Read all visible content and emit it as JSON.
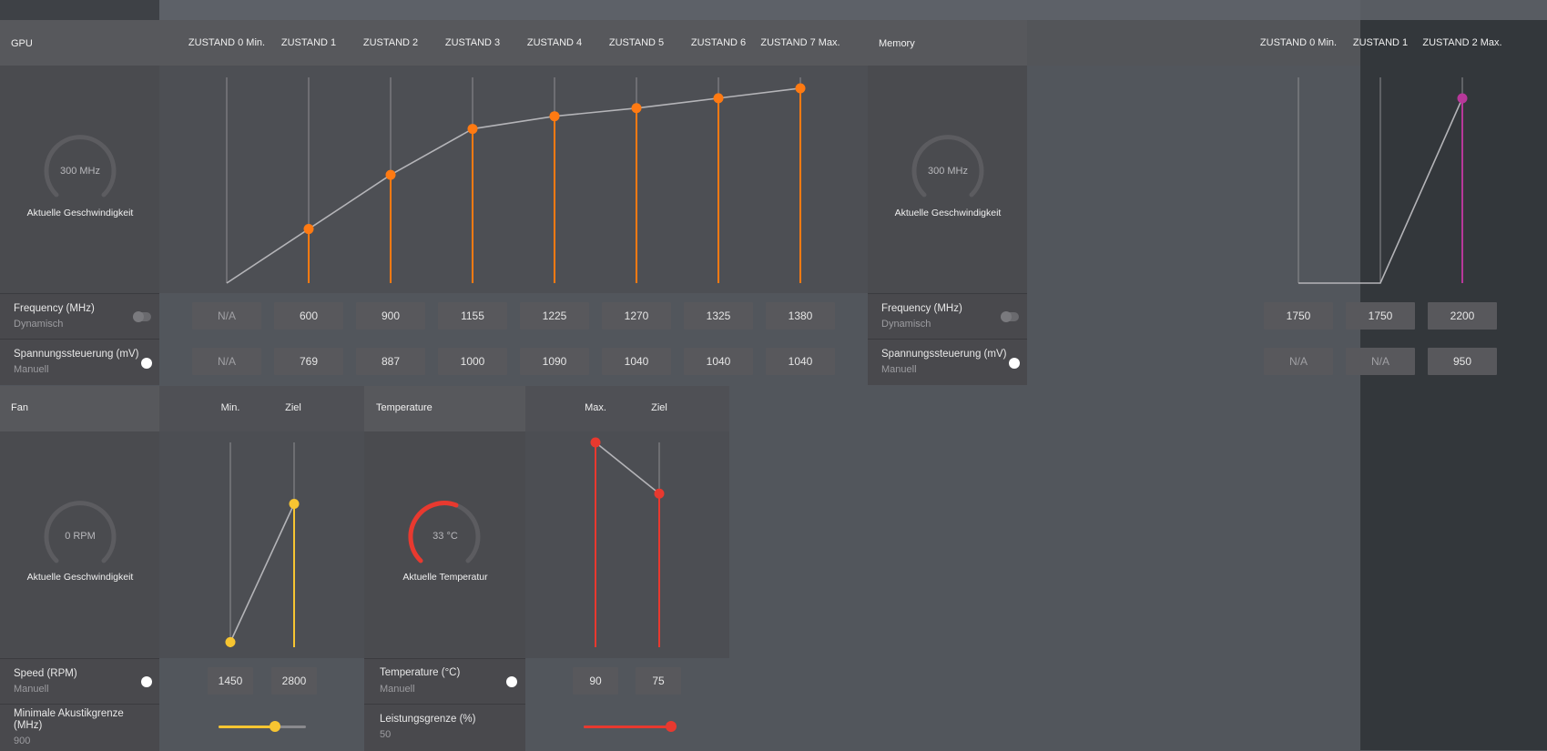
{
  "gpu": {
    "title": "GPU",
    "states": [
      "ZUSTAND 0 Min.",
      "ZUSTAND 1",
      "ZUSTAND 2",
      "ZUSTAND 3",
      "ZUSTAND 4",
      "ZUSTAND 5",
      "ZUSTAND 6",
      "ZUSTAND 7 Max."
    ],
    "gauge_value": "300 MHz",
    "gauge_label": "Aktuelle Geschwindigkeit",
    "frequency_label": "Frequency (MHz)",
    "frequency_mode": "Dynamisch",
    "frequencies": [
      "N/A",
      "600",
      "900",
      "1155",
      "1225",
      "1270",
      "1325",
      "1380"
    ],
    "voltage_label": "Spannungssteuerung (mV)",
    "voltage_mode": "Manuell",
    "voltages": [
      "N/A",
      "769",
      "887",
      "1000",
      "1090",
      "1040",
      "1040",
      "1040"
    ],
    "accent_color": "#ff7a12"
  },
  "memory": {
    "title": "Memory",
    "states": [
      "ZUSTAND 0 Min.",
      "ZUSTAND 1",
      "ZUSTAND 2 Max."
    ],
    "gauge_value": "300 MHz",
    "gauge_label": "Aktuelle Geschwindigkeit",
    "frequency_label": "Frequency (MHz)",
    "frequency_mode": "Dynamisch",
    "frequencies": [
      "1750",
      "1750",
      "2200"
    ],
    "voltage_label": "Spannungssteuerung (mV)",
    "voltage_mode": "Manuell",
    "voltages": [
      "N/A",
      "N/A",
      "950"
    ],
    "accent_color": "#b8389a"
  },
  "fan": {
    "title": "Fan",
    "columns": [
      "Min.",
      "Ziel"
    ],
    "gauge_value": "0 RPM",
    "gauge_label": "Aktuelle Geschwindigkeit",
    "speed_label": "Speed (RPM)",
    "speed_mode": "Manuell",
    "speeds": [
      "1450",
      "2800"
    ],
    "acoustic_label": "Minimale Akustikgrenze (MHz)",
    "acoustic_value": "900",
    "acoustic_level": 0.65,
    "accent_color": "#f7c531"
  },
  "temperature": {
    "title": "Temperature",
    "columns": [
      "Max.",
      "Ziel"
    ],
    "gauge_value": "33 °C",
    "gauge_label": "Aktuelle Temperatur",
    "temp_label": "Temperature (°C)",
    "temp_mode": "Manuell",
    "temps": [
      "90",
      "75"
    ],
    "power_label": "Leistungsgrenze (%)",
    "power_value": "50",
    "power_level": 1.0,
    "accent_color": "#e8392f"
  }
}
